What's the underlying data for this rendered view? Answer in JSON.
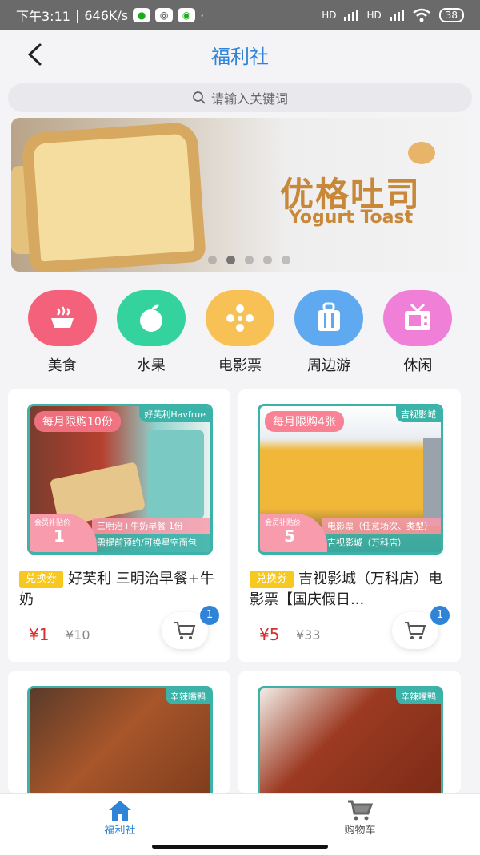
{
  "status_bar": {
    "time": "下午3:11",
    "speed": "646K/s",
    "network_1": "HD",
    "network_2": "HD",
    "battery": "38"
  },
  "nav": {
    "back_icon": "chevron-left-icon",
    "title": "福利社"
  },
  "search": {
    "placeholder": "请输入关键词",
    "icon": "search-icon"
  },
  "banner": {
    "title": "优格吐司",
    "subtitle": "Yogurt Toast",
    "slide_count": 5,
    "active_slide": 2
  },
  "categories": [
    {
      "label": "美食",
      "icon": "food-icon",
      "color": "#f4617a"
    },
    {
      "label": "水果",
      "icon": "fruit-icon",
      "color": "#34d39e"
    },
    {
      "label": "电影票",
      "icon": "film-reel-icon",
      "color": "#f8c155"
    },
    {
      "label": "周边游",
      "icon": "luggage-icon",
      "color": "#5fa9f0"
    },
    {
      "label": "休闲",
      "icon": "tv-icon",
      "color": "#f07fd8"
    }
  ],
  "products": [
    {
      "tag": "每月限购10份",
      "brand": "好芙利Havfrue",
      "member_price_label": "会员补贴价",
      "member_price": "1",
      "note_1": "三明治+牛奶早餐 1份",
      "note_2": "需提前预约/可换星空面包",
      "coupon": "兑换券",
      "name": "好芙利 三明治早餐+牛奶",
      "price": "¥1",
      "original_price": "¥10",
      "cart_count": "1"
    },
    {
      "tag": "每月限购4张",
      "brand": "吉视影城",
      "member_price_label": "会员补贴价",
      "member_price": "5",
      "note_1": "电影票（任意场次、类型）",
      "note_2": "吉视影城（万科店）",
      "coupon": "兑换券",
      "name": "吉视影城（万科店）电影票【国庆假日...",
      "price": "¥5",
      "original_price": "¥33",
      "cart_count": "1"
    },
    {
      "brand": "辛辣嘴鸭"
    },
    {
      "brand": "辛辣嘴鸭"
    }
  ],
  "tabbar": {
    "home_label": "福利社",
    "cart_label": "购物车",
    "accent": "#2f84d8"
  }
}
